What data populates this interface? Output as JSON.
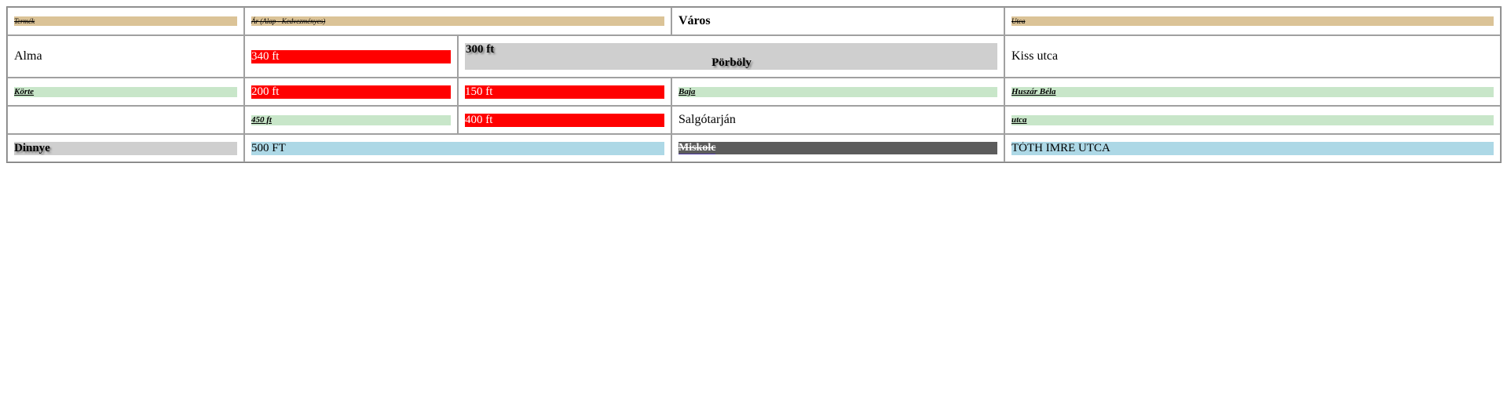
{
  "table": {
    "header": {
      "termek": "Termék",
      "ar": "Ár (Alap - Kedvezményes)",
      "varos": "Város",
      "utca": "Utca"
    },
    "rows": {
      "alma": {
        "name": "Alma",
        "price": "340 ft",
        "discount": "300 ft",
        "city": "Pörböly",
        "street": "Kiss utca"
      },
      "korte": {
        "name": "Körte",
        "price": "200 ft",
        "discount": "150 ft",
        "city": "Baja",
        "street": "Huszár Béla"
      },
      "second": {
        "name": "",
        "price": "450 ft",
        "discount": "400 ft",
        "city": "Salgótarján",
        "street": "utca"
      },
      "dinnye": {
        "name": "Dinnye",
        "price": "500 FT",
        "city": "Miskolc",
        "street": "TÓTH IMRE UTCA"
      }
    },
    "colors": {
      "tan": "#dbc397",
      "red": "#ff0000",
      "green": "#c8e6c9",
      "gray": "#cfcfcf",
      "blue": "#add8e6",
      "dark": "#5c5c5c"
    }
  }
}
